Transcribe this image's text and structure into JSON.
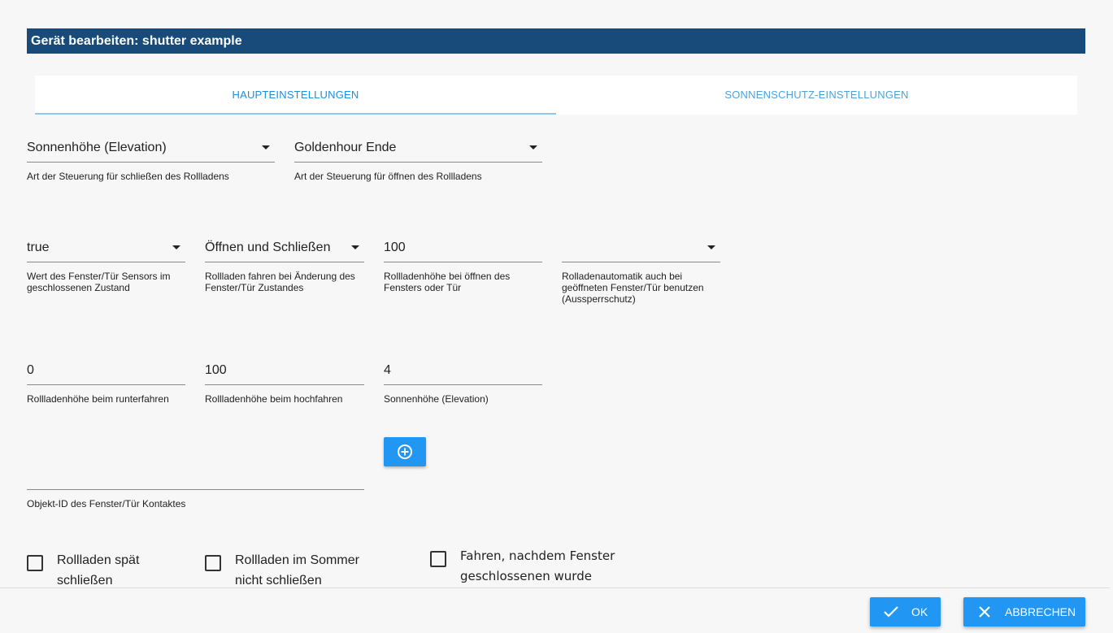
{
  "dialog": {
    "title": "Gerät bearbeiten: shutter example"
  },
  "tabs": [
    {
      "label": "HAUPTEINSTELLUNGEN",
      "active": true
    },
    {
      "label": "SONNENSCHUTZ-EINSTELLUNGEN",
      "active": false
    }
  ],
  "fields": {
    "close_control": {
      "value": "Sonnenhöhe (Elevation)",
      "label": "Art der Steuerung für schließen des Rollladens"
    },
    "open_control": {
      "value": "Goldenhour Ende",
      "label": "Art der Steuerung für öffnen des Rollladens"
    },
    "sensor_value": {
      "value": "true",
      "label": "Wert des Fenster/Tür Sensors im geschlossenen Zustand"
    },
    "drive_on_change": {
      "value": "Öffnen und Schließen",
      "label": "Rollladen fahren bei Änderung des Fenster/Tür Zustandes"
    },
    "height_on_open_window": {
      "value": "100",
      "label": "Rollladenhöhe bei öffnen des Fensters oder Tür"
    },
    "lockout_protection": {
      "value": "",
      "label": "Rolladenautomatik auch bei geöffneten Fenster/Tür benutzen (Aussperrschutz)"
    },
    "height_down": {
      "value": "0",
      "label": "Rollladenhöhe beim runterfahren"
    },
    "height_up": {
      "value": "100",
      "label": "Rollladenhöhe beim hochfahren"
    },
    "elevation": {
      "value": "4",
      "label": "Sonnenhöhe (Elevation)"
    },
    "object_id": {
      "value": "",
      "label": "Objekt-ID des Fenster/Tür Kontaktes"
    }
  },
  "checkboxes": {
    "late_close": {
      "label": "Rollladen spät schließen",
      "checked": false
    },
    "summer_no_close": {
      "label": "Rollladen im Sommer nicht schließen",
      "checked": false
    },
    "drive_after_window_closed": {
      "label": "Fahren, nachdem Fenster geschlossenen wurde",
      "checked": false
    }
  },
  "buttons": {
    "ok": "OK",
    "cancel": "ABBRECHEN",
    "add_icon": "plus-circle-icon"
  },
  "colors": {
    "title_bar": "#184b7a",
    "accent": "#2196f3",
    "tab_text": "#4aa3df"
  }
}
